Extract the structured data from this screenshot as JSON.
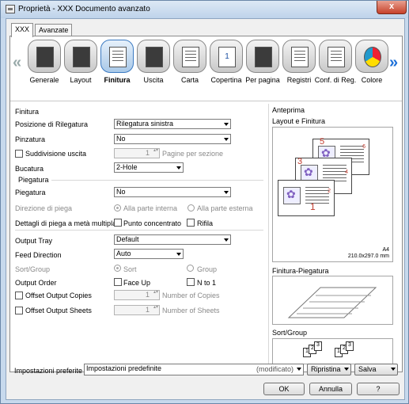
{
  "window": {
    "title": "Proprietà - XXX Documento avanzato",
    "close_label": "x"
  },
  "tabs": [
    {
      "label": "XXX"
    },
    {
      "label": "Avanzate"
    }
  ],
  "icons": [
    {
      "label": "Generale"
    },
    {
      "label": "Layout"
    },
    {
      "label": "Finitura"
    },
    {
      "label": "Uscita"
    },
    {
      "label": "Carta"
    },
    {
      "label": "Copertina"
    },
    {
      "label": "Per pagina"
    },
    {
      "label": "Registri"
    },
    {
      "label": "Conf. di Reg."
    },
    {
      "label": "Colore"
    }
  ],
  "nav": {
    "left": "«",
    "right": "»"
  },
  "finitura": {
    "section_title": "Finitura",
    "posizione_label": "Posizione di Rilegatura",
    "posizione_value": "Rilegatura sinistra",
    "pinzatura_label": "Pinzatura",
    "pinzatura_value": "No",
    "suddivisione_label": "Suddivisione uscita",
    "pagine_value": "1",
    "pagine_label": "Pagine per sezione",
    "bucatura_label": "Bucatura",
    "bucatura_value": "2-Hole"
  },
  "piegatura": {
    "section_title": "Piegatura",
    "piegatura_label": "Piegatura",
    "piegatura_value": "No",
    "direzione_label": "Direzione di piega",
    "interna_label": "Alla parte interna",
    "esterna_label": "Alla parte esterna",
    "dettagli_label": "Dettagli di piega a metà multipla",
    "punto_label": "Punto concentrato",
    "rifila_label": "Rifila"
  },
  "output": {
    "tray_label": "Output Tray",
    "tray_value": "Default",
    "feed_label": "Feed Direction",
    "feed_value": "Auto",
    "sortgroup_label": "Sort/Group",
    "sort_label": "Sort",
    "group_label": "Group",
    "order_label": "Output Order",
    "faceup_label": "Face Up",
    "nto1_label": "N to 1",
    "offset_copies_label": "Offset Output Copies",
    "copies_value": "1",
    "copies_unit": "Number of Copies",
    "offset_sheets_label": "Offset Output Sheets",
    "sheets_value": "1",
    "sheets_unit": "Number of Sheets"
  },
  "preview": {
    "section_title": "Anteprima",
    "layout_label": "Layout e Finitura",
    "paper_size": "A4",
    "paper_dims": "210.0x297.0 mm",
    "page_numbers": [
      "5",
      "3",
      "1"
    ],
    "back_numbers": [
      "6",
      "4",
      "2"
    ],
    "fold_label": "Finitura-Piegatura",
    "sort_label": "Sort/Group",
    "sort_digits": [
      "1",
      "2",
      "3",
      "1",
      "2",
      "3"
    ]
  },
  "footer": {
    "preferite_label": "Impostazioni preferite",
    "preferite_value": "Impostazioni predefinite",
    "modificato": "(modificato)",
    "ripristina_label": "Ripristina",
    "salva_label": "Salva",
    "ok_label": "OK",
    "annulla_label": "Annulla",
    "help_label": "?"
  }
}
